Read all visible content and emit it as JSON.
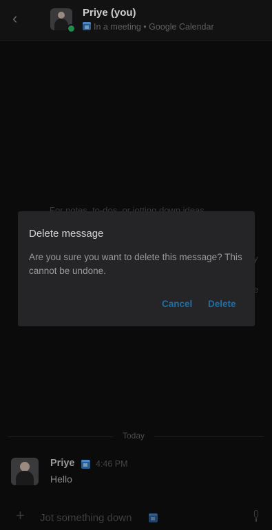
{
  "header": {
    "back_glyph": "‹",
    "name": "Priye (you)",
    "status": "In a meeting • Google Calendar"
  },
  "background_text": {
    "line1": "For notes, to-dos, or jotting down ideas",
    "right_fragment_1": "y",
    "right_fragment_2": "e"
  },
  "dialog": {
    "title": "Delete message",
    "body": "Are you sure you want to delete this message? This cannot be undone.",
    "cancel_label": "Cancel",
    "delete_label": "Delete"
  },
  "timeline": {
    "date_divider": "Today"
  },
  "message": {
    "author": "Priye",
    "time": "4:46 PM",
    "text": "Hello"
  },
  "composer": {
    "plus_glyph": "+",
    "placeholder": "Jot something down"
  },
  "colors": {
    "background": "#0b0b0c",
    "dialog": "#252527",
    "accent": "#1d6fa5",
    "presence": "#1f8b4c"
  },
  "icons": [
    "back-icon",
    "calendar-icon",
    "plus-icon",
    "microphone-icon"
  ]
}
